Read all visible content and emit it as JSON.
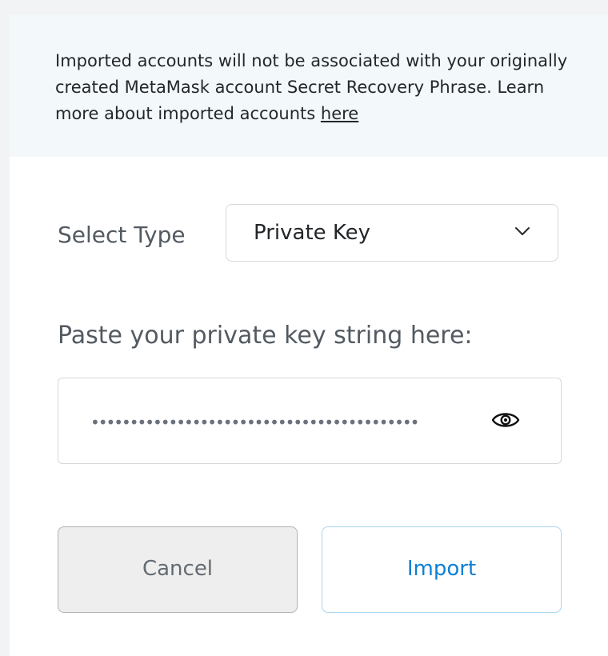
{
  "notice": {
    "text": "Imported accounts will not be associated with your originally created MetaMask account Secret Recovery Phrase. Learn more about imported accounts ",
    "link_label": "here"
  },
  "select_type": {
    "label": "Select Type",
    "selected_value": "Private Key",
    "dropdown_icon": "chevron-down-icon"
  },
  "private_key": {
    "label": "Paste your private key string here:",
    "masked_value": "••••••••••••••••••••••••••••••••••••••••••",
    "toggle_icon": "eye-icon"
  },
  "actions": {
    "cancel_label": "Cancel",
    "import_label": "Import"
  },
  "colors": {
    "notice_background": "#f3f8fa",
    "primary_blue": "#0f7fd4",
    "import_border": "#a9d4f0",
    "cancel_background": "#eeeeee"
  }
}
